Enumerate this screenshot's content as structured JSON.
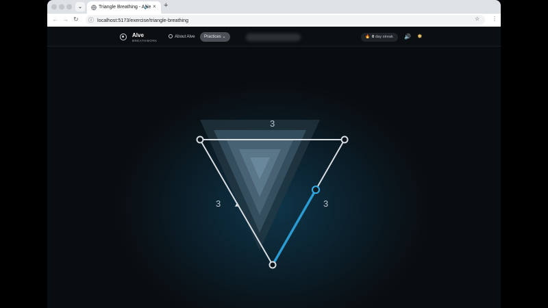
{
  "browser": {
    "tab_title": "Triangle Breathing - Alve",
    "url": "localhost:5173/exercise/triangle-breathing",
    "new_tab_label": "+",
    "tab_list_label": "⌄",
    "tab_close_label": "×",
    "back_label": "←",
    "forward_label": "→",
    "reload_label": "↻",
    "site_info_label": "ⓘ",
    "bookmark_label": "☆",
    "menu_label": "⋮",
    "speaker_label": "🔊"
  },
  "header": {
    "brand": "Alve",
    "brand_sub": "BREATHWORK",
    "about_label": "About Alve",
    "practices_label": "Practices ⌄",
    "streak_icon": "🔥",
    "streak_count": "0",
    "streak_label": "day streak",
    "sound_icon": "🔊",
    "theme_icon": "✹"
  },
  "exercise": {
    "top_count": "3",
    "left_count": "3",
    "right_count": "3",
    "progress_on_right_side": 0.6,
    "accent": "#2b9bd1"
  }
}
